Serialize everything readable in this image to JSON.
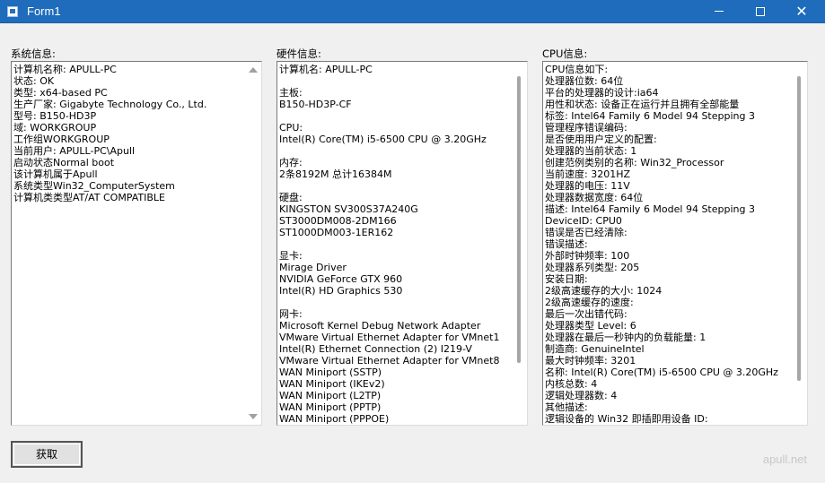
{
  "window": {
    "title": "Form1"
  },
  "labels": {
    "system": "系统信息:",
    "hardware": "硬件信息:",
    "cpu": "CPU信息:"
  },
  "system_info": [
    "计算机名称: APULL-PC",
    "状态: OK",
    "类型: x64-based PC",
    "生产厂家: Gigabyte Technology Co., Ltd.",
    "型号: B150-HD3P",
    "域: WORKGROUP",
    "工作组WORKGROUP",
    "当前用户: APULL-PC\\Apull",
    "启动状态Normal boot",
    "该计算机属于Apull",
    "系统类型Win32_ComputerSystem",
    "计算机类类型AT/AT COMPATIBLE"
  ],
  "hardware_info": [
    "计算机名: APULL-PC",
    "",
    "主板:",
    "B150-HD3P-CF",
    "",
    "CPU:",
    "Intel(R) Core(TM) i5-6500 CPU @ 3.20GHz",
    "",
    "内存:",
    "2条8192M 总计16384M",
    "",
    "硬盘:",
    "KINGSTON SV300S37A240G",
    "ST3000DM008-2DM166",
    "ST1000DM003-1ER162",
    "",
    "显卡:",
    "Mirage Driver",
    "NVIDIA GeForce GTX 960",
    "Intel(R) HD Graphics 530",
    "",
    "网卡:",
    "Microsoft Kernel Debug Network Adapter",
    "VMware Virtual Ethernet Adapter for VMnet1",
    "Intel(R) Ethernet Connection (2) I219-V",
    "VMware Virtual Ethernet Adapter for VMnet8",
    "WAN Miniport (SSTP)",
    "WAN Miniport (IKEv2)",
    "WAN Miniport (L2TP)",
    "WAN Miniport (PPTP)",
    "WAN Miniport (PPPOE)"
  ],
  "cpu_info": [
    "CPU信息如下:",
    "处理器位数: 64位",
    "平台的处理器的设计:ia64",
    "用性和状态: 设备正在运行并且拥有全部能量",
    "标签: Intel64 Family 6 Model 94 Stepping 3",
    "管理程序错误编码:",
    "是否使用用户定义的配置:",
    "处理器的当前状态: 1",
    "创建范例类别的名称: Win32_Processor",
    "当前速度: 3201HZ",
    "处理器的电压: 11V",
    "处理器数据宽度: 64位",
    "描述: Intel64 Family 6 Model 94 Stepping 3",
    "DeviceID: CPU0",
    "错误是否已经清除:",
    "错误描述:",
    "外部时钟频率: 100",
    "处理器系列类型: 205",
    "安装日期:",
    "2级高速缓存的大小: 1024",
    "2级高速缓存的速度:",
    "最后一次出错代码:",
    "处理器类型 Level: 6",
    "处理器在最后一秒钟内的负载能量: 1",
    "制造商: GenuineIntel",
    "最大时钟频率: 3201",
    "名称: Intel(R) Core(TM) i5-6500 CPU @ 3.20GHz",
    "内核总数: 4",
    "逻辑处理器数: 4",
    "其他描述:",
    "逻辑设备的 Win32 即插即用设备 ID:"
  ],
  "button": {
    "get_label": "获取"
  },
  "watermark": "apull.net",
  "icons": {
    "app": "form-icon",
    "minimize": "minimize-icon",
    "maximize": "maximize-icon",
    "close": "close-icon"
  }
}
